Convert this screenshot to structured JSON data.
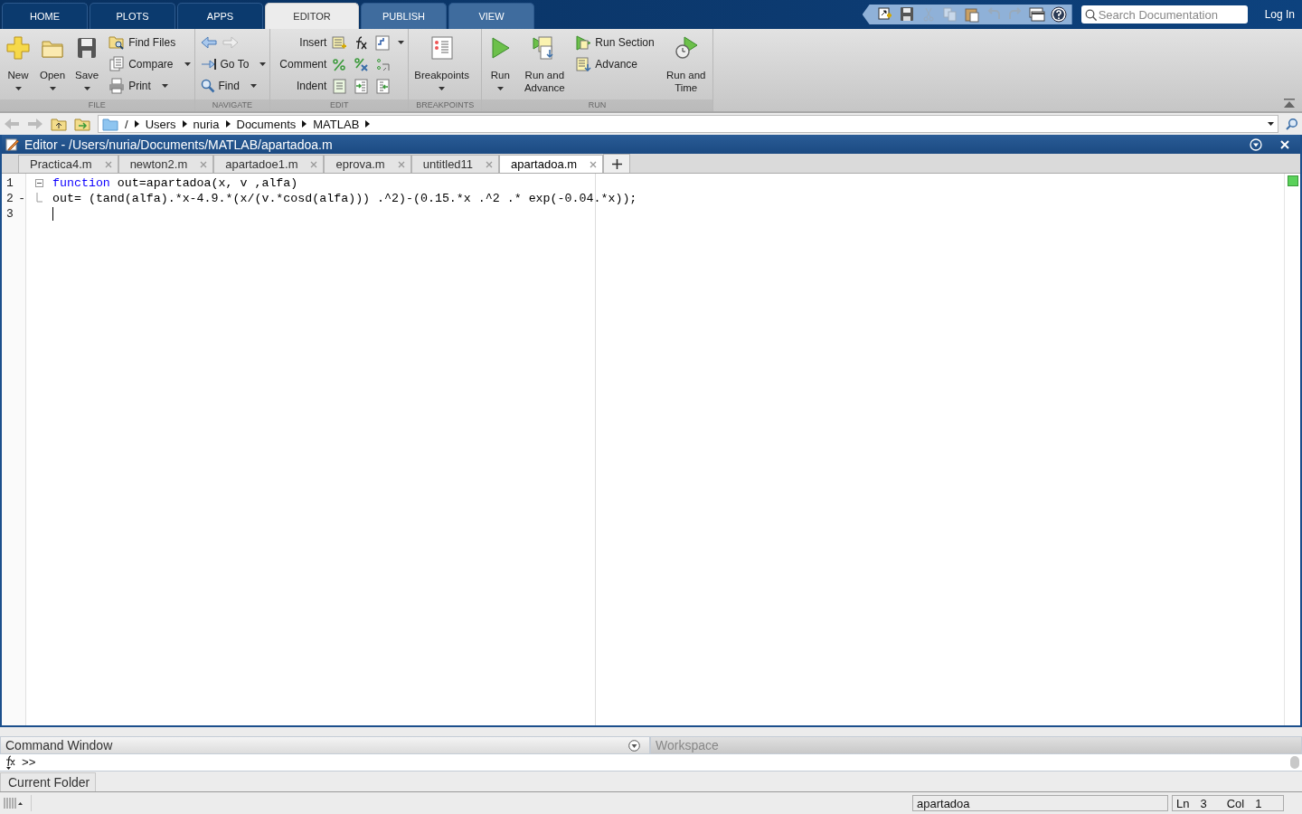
{
  "tabs": [
    {
      "label": "HOME",
      "selected": false
    },
    {
      "label": "PLOTS",
      "selected": false
    },
    {
      "label": "APPS",
      "selected": false
    },
    {
      "label": "EDITOR",
      "selected": true
    },
    {
      "label": "PUBLISH",
      "selected": false
    },
    {
      "label": "VIEW",
      "selected": false
    }
  ],
  "search": {
    "placeholder": "Search Documentation"
  },
  "login": "Log In",
  "toolstrip": {
    "sections": [
      {
        "title": "FILE",
        "columns": [
          {
            "kind": "large",
            "label": "New",
            "dropdown": true
          },
          {
            "kind": "large",
            "label": "Open",
            "dropdown": true
          },
          {
            "kind": "large",
            "label": "Save",
            "dropdown": true
          },
          {
            "kind": "stack",
            "rows": [
              {
                "kind": "button",
                "label": "Find Files",
                "dropdown": false
              },
              {
                "kind": "button",
                "label": "Compare",
                "dropdown": true
              },
              {
                "kind": "button",
                "label": "Print",
                "dropdown": true
              }
            ]
          }
        ]
      },
      {
        "title": "NAVIGATE",
        "columns": [
          {
            "kind": "stack",
            "rows": [
              {
                "kind": "arrows"
              },
              {
                "kind": "button",
                "label": "Go To",
                "dropdown": true
              },
              {
                "kind": "button",
                "label": "Find",
                "dropdown": true
              }
            ]
          }
        ]
      },
      {
        "title": "EDIT",
        "columns": [
          {
            "kind": "stack",
            "rows": [
              {
                "kind": "icon_group",
                "label": "Insert",
                "dropdown": true
              },
              {
                "kind": "icon_group",
                "label": "Comment",
                "dropdown": false
              },
              {
                "kind": "icon_group",
                "label": "Indent",
                "dropdown": false
              }
            ]
          }
        ]
      },
      {
        "title": "BREAKPOINTS",
        "columns": [
          {
            "kind": "large",
            "label": "Breakpoints",
            "dropdown": true
          }
        ]
      },
      {
        "title": "RUN",
        "columns": [
          {
            "kind": "large",
            "label": "Run",
            "dropdown": true
          },
          {
            "kind": "large",
            "label": "Run and Advance",
            "dropdown": false
          },
          {
            "kind": "stack",
            "rows": [
              {
                "kind": "button",
                "label": "Run Section",
                "dropdown": false
              },
              {
                "kind": "button",
                "label": "Advance",
                "dropdown": false
              }
            ]
          },
          {
            "kind": "large",
            "label": "Run and Time",
            "dropdown": false
          }
        ]
      }
    ]
  },
  "address_bar": {
    "path": [
      "/",
      "Users",
      "nuria",
      "Documents",
      "MATLAB"
    ]
  },
  "editor": {
    "title": "Editor - /Users/nuria/Documents/MATLAB/apartadoa.m",
    "tabs": [
      {
        "label": "Practica4.m",
        "selected": false
      },
      {
        "label": "newton2.m",
        "selected": false
      },
      {
        "label": "apartadoe1.m",
        "selected": false
      },
      {
        "label": "eprova.m",
        "selected": false
      },
      {
        "label": "untitled11",
        "selected": false
      },
      {
        "label": "apartadoa.m",
        "selected": true
      }
    ],
    "lines": [
      {
        "number": "1",
        "kind": "fold_start",
        "cursor": false,
        "tokens": [
          {
            "kind": "keyword",
            "text": "function"
          },
          {
            "kind": "plain",
            "text": " out=apartadoa(x, v ,alfa)"
          }
        ]
      },
      {
        "number": "2",
        "marker": "-",
        "kind": "fold_end",
        "cursor": false,
        "tokens": [
          {
            "kind": "plain",
            "text": "out= (tand(alfa).*x-4.9.*(x/(v.*cosd(alfa))) .^2)-(0.15.*x .^2 .* exp(-0.04.*x));"
          }
        ]
      },
      {
        "number": "3",
        "kind": "plain",
        "cursor": true
      }
    ]
  },
  "command_window": {
    "title": "Command Window",
    "prompt": ">>"
  },
  "workspace": {
    "title": "Workspace"
  },
  "current_folder": {
    "title": "Current Folder"
  },
  "status_bar": {
    "file": "apartadoa",
    "ln_label": "Ln",
    "ln": "3",
    "col_label": "Col",
    "col": "1"
  }
}
